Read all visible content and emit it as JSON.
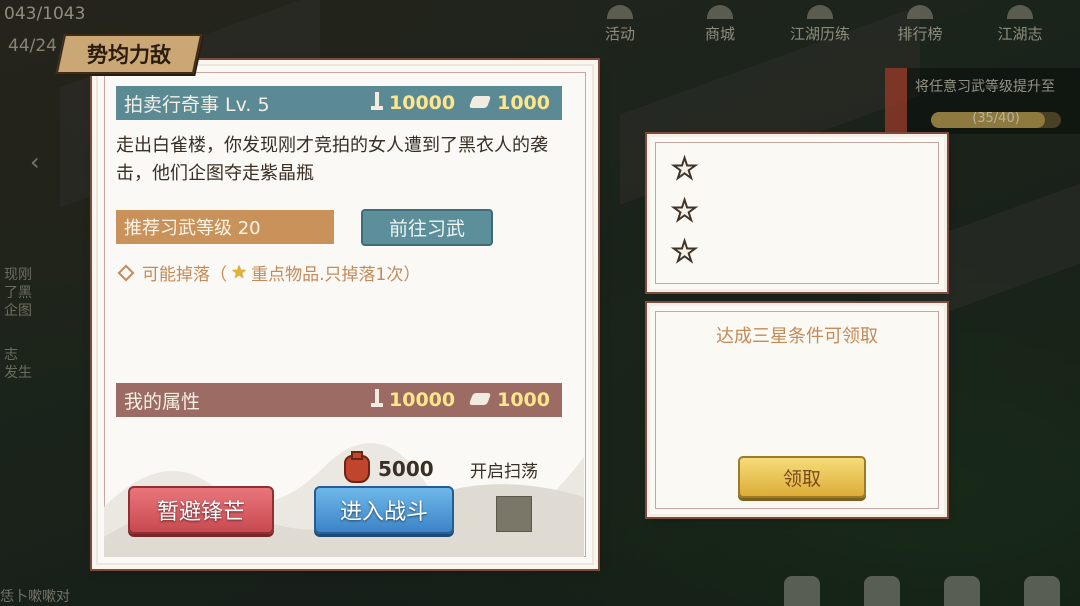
{
  "hud": {
    "hp": "043/1043",
    "mp": "44/24"
  },
  "topnav": [
    {
      "label": "活动",
      "icon": "activity-icon"
    },
    {
      "label": "商城",
      "icon": "shop-icon"
    },
    {
      "label": "江湖历练",
      "icon": "training-icon"
    },
    {
      "label": "排行榜",
      "icon": "leaderboard-icon"
    },
    {
      "label": "江湖志",
      "icon": "chronicle-icon"
    }
  ],
  "quest": {
    "text": "将任意习武等级提升至",
    "progress": "(35/40)",
    "progress_fraction": 0.875
  },
  "side_ghost": {
    "lines_a": [
      "现刚",
      "了黑",
      "企图"
    ],
    "lines_b": [
      "志",
      "发生"
    ]
  },
  "bottom_ghost": "恁卜嗽嗽对",
  "panel": {
    "title": "势均力敌",
    "event": {
      "name": "拍卖行奇事 Lv. 5",
      "power_attack": "10000",
      "power_defense": "1000"
    },
    "description": "走出白雀楼，你发现刚才竞拍的女人遭到了黑衣人的袭击，他们企图夺走紫晶瓶",
    "recommend_level": "推荐习武等级 20",
    "goto_label": "前往习武",
    "drops_label": "可能掉落（",
    "drops_note": "重点物品.只掉落1次）",
    "self": {
      "label": "我的属性",
      "power_attack": "10000",
      "power_defense": "1000"
    },
    "cost": "5000",
    "sweep_label": "开启扫荡",
    "retreat_label": "暂避锋芒",
    "battle_label": "进入战斗"
  },
  "stars_panel": {
    "stars": [
      "star-1",
      "star-2",
      "star-3"
    ]
  },
  "reward_panel": {
    "hint": "达成三星条件可领取",
    "claim_label": "领取"
  }
}
